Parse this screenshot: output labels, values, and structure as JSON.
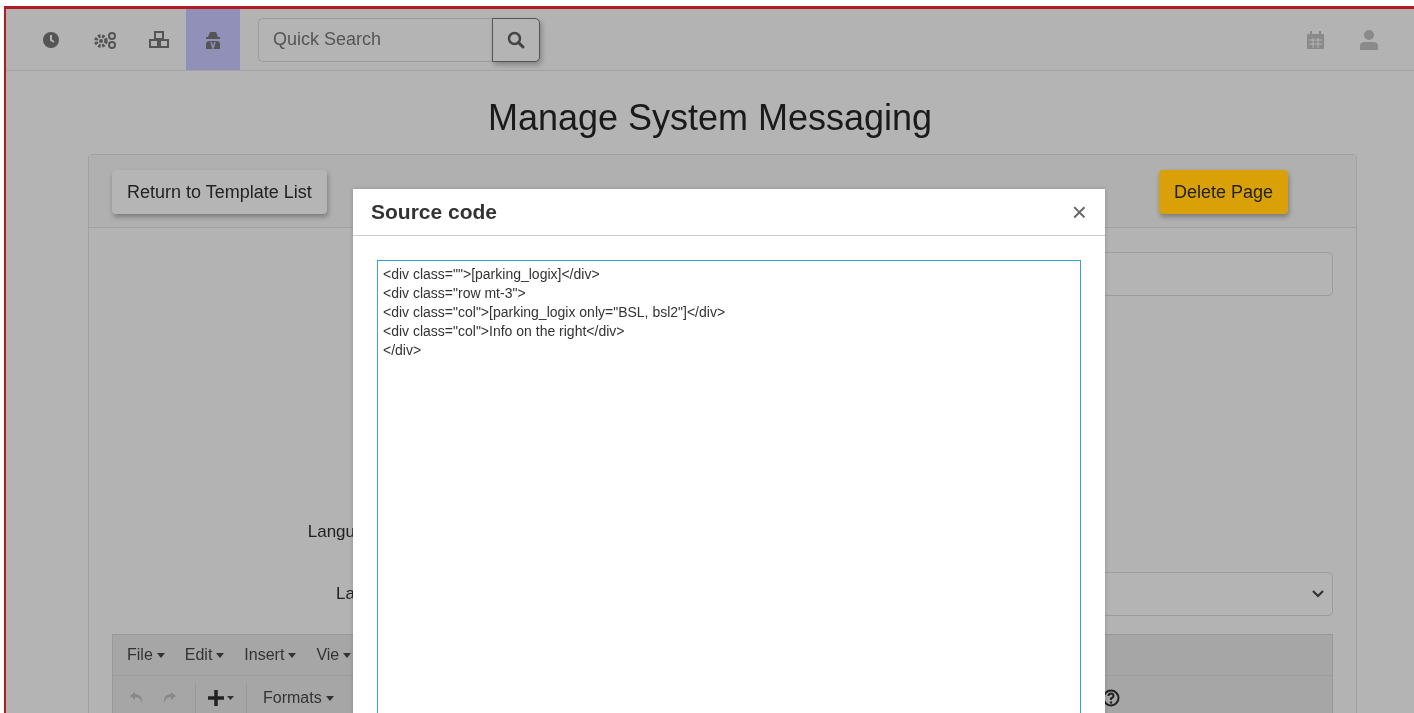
{
  "nav": {
    "items": [
      {
        "kind": "clock",
        "selected": false
      },
      {
        "kind": "gears",
        "selected": false
      },
      {
        "kind": "cubes",
        "selected": false
      },
      {
        "kind": "spy",
        "selected": true
      }
    ],
    "search": {
      "placeholder": "Quick Search"
    }
  },
  "page": {
    "title": "Manage System Messaging"
  },
  "card": {
    "return_button": "Return to Template List",
    "delete_button": "Delete Page",
    "form_labels": [
      "Langu",
      "La"
    ],
    "editor": {
      "menus": [
        "File",
        "Edit",
        "Insert",
        "Vie"
      ],
      "formats": "Formats"
    }
  },
  "modal": {
    "title": "Source code",
    "close": "×",
    "code_lines": [
      "<div class=\"\">[parking_logix]</div>",
      "<div class=\"row mt-3\">",
      "<div class=\"col\">[parking_logix only=\"BSL, bsl2\"]</div>",
      "<div class=\"col\">Info on the right</div>",
      "</div>"
    ]
  }
}
